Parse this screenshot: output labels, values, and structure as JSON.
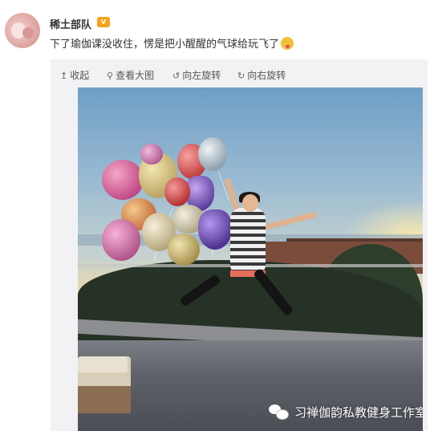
{
  "post": {
    "username": "稀土部队",
    "vip_badge": "V",
    "text": "下了瑜伽课没收住，愣是把小醒醒的气球给玩飞了",
    "emoji": "tongue-out-emoji"
  },
  "toolbar": {
    "collapse_label": "收起",
    "view_large_label": "查看大图",
    "rotate_left_label": "向左旋转",
    "rotate_right_label": "向右旋转"
  },
  "photo": {
    "watermark_text": "习禅伽韵私教健身工作室"
  },
  "icons": {
    "collapse": "arrow-up-icon",
    "view_large": "search-icon",
    "rotate_left": "rotate-left-icon",
    "rotate_right": "rotate-right-icon",
    "watermark": "wechat-icon"
  },
  "colors": {
    "badge": "#f7a21b",
    "text": "#333333",
    "card_bg": "#f2f2f5"
  }
}
